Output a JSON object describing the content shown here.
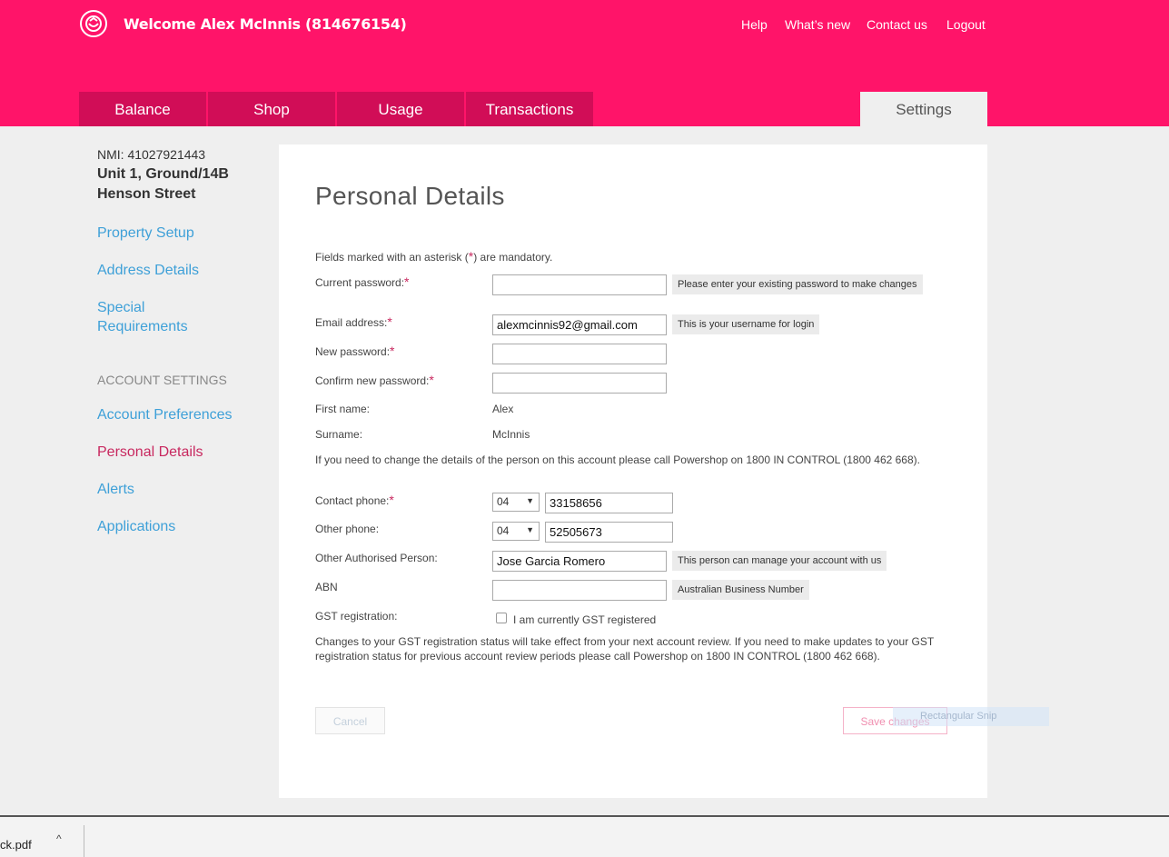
{
  "header": {
    "welcome": "Welcome Alex McInnis (814676154)",
    "nav": [
      "Help",
      "What’s new",
      "Contact us",
      "Logout"
    ],
    "tabs": [
      "Balance",
      "Shop",
      "Usage",
      "Transactions"
    ],
    "settings_tab": "Settings",
    "brand_color": "#ff1469"
  },
  "sidebar": {
    "nmi": "NMI: 41027921443",
    "address_line1": "Unit 1, Ground/14B",
    "address_line2": "Henson Street",
    "links": [
      "Property Setup",
      "Address Details",
      "Special",
      "Requirements"
    ],
    "account_heading": "ACCOUNT SETTINGS",
    "account_links": [
      "Account Preferences",
      "Personal Details",
      "Alerts",
      "Applications"
    ],
    "active": "Personal Details"
  },
  "form": {
    "title": "Personal Details",
    "mandatory_note_pre": "Fields marked with an asterisk (",
    "asterisk": "*",
    "mandatory_note_post": ") are mandatory.",
    "current_password_label": "Current password:",
    "current_password_hint": "Please enter your existing password to make changes",
    "email_label": "Email address:",
    "email_value": "alexmcinnis92@gmail.com",
    "email_hint": "This is your username for login",
    "new_password_label": "New password:",
    "confirm_password_label": "Confirm new password:",
    "first_name_label": "First name:",
    "first_name_value": "Alex",
    "surname_label": "Surname:",
    "surname_value": "McInnis",
    "change_note": "If you need to change the details of the person on this account please call Powershop on 1800 IN CONTROL (1800 462 668).",
    "contact_phone_label": "Contact phone:",
    "contact_phone_prefix": "04",
    "contact_phone_value": "33158656",
    "other_phone_label": "Other phone:",
    "other_phone_prefix": "04",
    "other_phone_value": "52505673",
    "other_person_label": "Other Authorised Person:",
    "other_person_value": "Jose Garcia Romero",
    "other_person_hint": "This person can manage your account with us",
    "abn_label": "ABN",
    "abn_hint": "Australian Business Number",
    "gst_label": "GST registration:",
    "gst_checkbox_label": "I am currently GST registered",
    "gst_note_line1": "Changes to your GST registration status will take effect from your next account review. If you need to make updates to your GST",
    "gst_note_line2": "registration status for previous account review periods please call Powershop on 1800 IN CONTROL (1800 462 668).",
    "cancel_label": "Cancel",
    "save_label": "Save changes",
    "snip_overlay": "Rectangular Snip"
  },
  "download_bar": {
    "file_name": "ck.pdf",
    "chevron": "^"
  }
}
